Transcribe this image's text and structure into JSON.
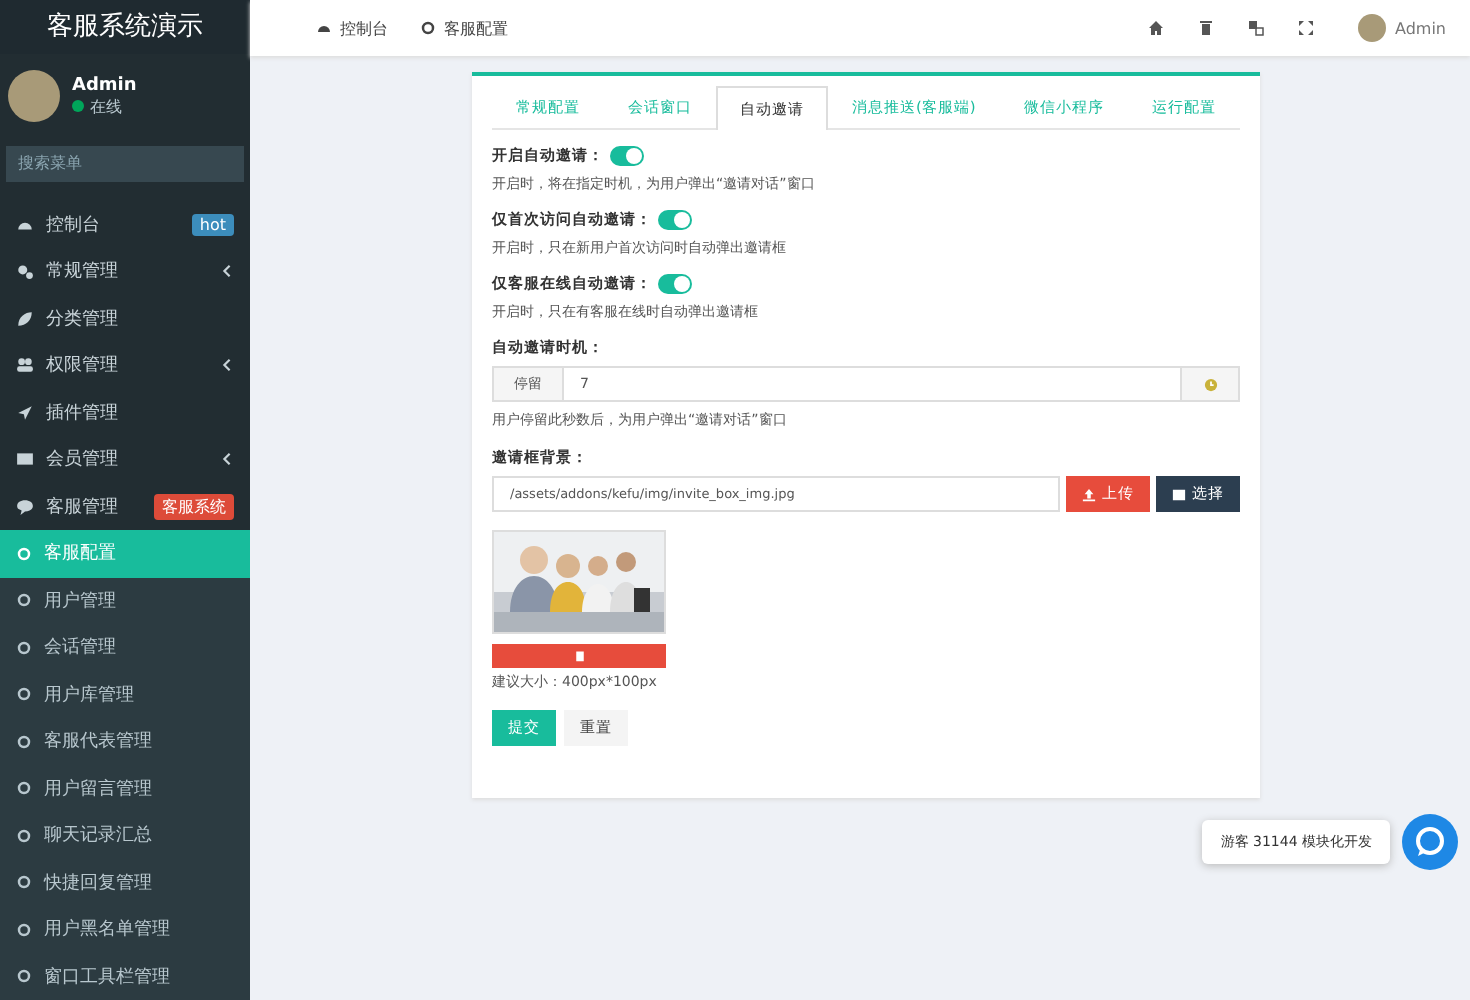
{
  "sidebar": {
    "title": "客服系统演示",
    "user": {
      "name": "Admin",
      "status": "在线",
      "online": true
    },
    "search": {
      "placeholder": "搜索菜单"
    },
    "items": [
      {
        "label": "控制台",
        "kind": "link",
        "badge": {
          "text": "hot",
          "color": "#3c8dbc"
        }
      },
      {
        "label": "常规管理",
        "kind": "group",
        "expanded": false
      },
      {
        "label": "分类管理",
        "kind": "link"
      },
      {
        "label": "权限管理",
        "kind": "group",
        "expanded": false
      },
      {
        "label": "插件管理",
        "kind": "link"
      },
      {
        "label": "会员管理",
        "kind": "group",
        "expanded": false
      },
      {
        "label": "客服管理",
        "kind": "group",
        "expanded": true,
        "badge": {
          "text": "客服系统",
          "color": "#dd4b39"
        },
        "children": [
          {
            "label": "客服配置",
            "selected": true
          },
          {
            "label": "用户管理",
            "selected": false
          },
          {
            "label": "会话管理",
            "selected": false
          },
          {
            "label": "用户库管理",
            "selected": false
          },
          {
            "label": "客服代表管理",
            "selected": false
          },
          {
            "label": "用户留言管理",
            "selected": false
          },
          {
            "label": "聊天记录汇总",
            "selected": false
          },
          {
            "label": "快捷回复管理",
            "selected": false
          },
          {
            "label": "用户黑名单管理",
            "selected": false
          },
          {
            "label": "窗口工具栏管理",
            "selected": false
          }
        ]
      }
    ]
  },
  "topbar": {
    "breadcrumbs": [
      {
        "label": "控制台"
      },
      {
        "label": "客服配置"
      }
    ],
    "user": "Admin"
  },
  "config": {
    "tabs": [
      {
        "label": "常规配置",
        "selected": false
      },
      {
        "label": "会话窗口",
        "selected": false
      },
      {
        "label": "自动邀请",
        "selected": true
      },
      {
        "label": "消息推送(客服端)",
        "selected": false
      },
      {
        "label": "微信小程序",
        "selected": false
      },
      {
        "label": "运行配置",
        "selected": false
      }
    ],
    "toggles": [
      {
        "label": "开启自动邀请：",
        "on": true,
        "help": "开启时，将在指定时机，为用户弹出“邀请对话”窗口"
      },
      {
        "label": "仅首次访问自动邀请：",
        "on": true,
        "help": "开启时，只在新用户首次访问时自动弹出邀请框"
      },
      {
        "label": "仅客服在线自动邀请：",
        "on": true,
        "help": "开启时，只在有客服在线时自动弹出邀请框"
      }
    ],
    "timing": {
      "label": "自动邀请时机：",
      "addon": "停留",
      "value": "7",
      "help": "用户停留此秒数后，为用户弹出“邀请对话”窗口"
    },
    "background": {
      "label": "邀请框背景：",
      "value": "/assets/addons/kefu/img/invite_box_img.jpg",
      "upload": "上传",
      "choose": "选择",
      "hint": "建议大小：400px*100px"
    },
    "buttons": [
      {
        "label": "提交",
        "kind": "primary"
      },
      {
        "label": "重置",
        "kind": "default"
      }
    ]
  },
  "float_chat": {
    "text": "游客 31144 模块化开发"
  }
}
